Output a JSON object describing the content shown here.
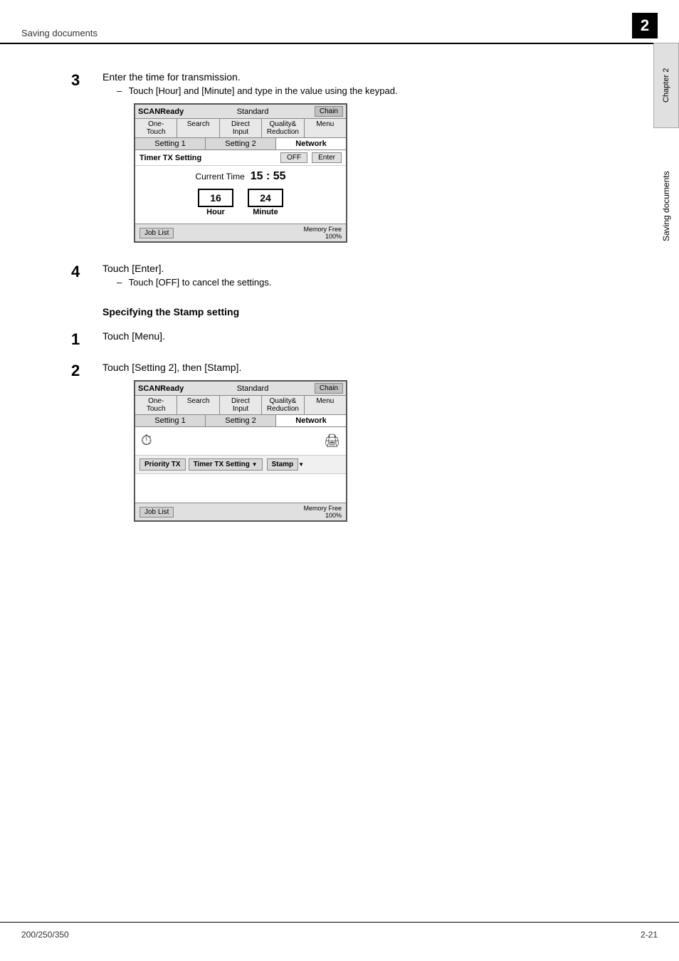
{
  "header": {
    "left_label": "Saving documents",
    "chapter_number": "2"
  },
  "sidebar": {
    "chapter_label": "Chapter 2",
    "saving_label": "Saving documents"
  },
  "steps": [
    {
      "number": "3",
      "main_text": "Enter the time for transmission.",
      "sub_text": "Touch [Hour] and [Minute] and type in the value using the keypad."
    },
    {
      "number": "4",
      "main_text": "Touch [Enter].",
      "sub_text": "Touch [OFF] to cancel the settings."
    }
  ],
  "stamp_section": {
    "heading": "Specifying the Stamp setting",
    "step1": {
      "number": "1",
      "text": "Touch [Menu]."
    },
    "step2": {
      "number": "2",
      "text": "Touch [Setting 2], then [Stamp]."
    }
  },
  "panel1": {
    "scan_ready": "SCANReady",
    "standard": "Standard",
    "chain_btn": "Chain",
    "nav_items": [
      "One-Touch",
      "Search",
      "Direct Input",
      "Quality& Reduction",
      "Menu"
    ],
    "tabs": [
      "Setting 1",
      "Setting 2",
      "Network"
    ],
    "timer_label": "Timer TX Setting",
    "off_btn": "OFF",
    "enter_btn": "Enter",
    "current_time_label": "Current Time",
    "current_time_value": "15 : 55",
    "hour_value": "16",
    "hour_label": "Hour",
    "minute_value": "24",
    "minute_label": "Minute",
    "job_list": "Job List",
    "memory_free": "Memory Free",
    "memory_percent": "100%"
  },
  "panel2": {
    "scan_ready": "SCANReady",
    "standard": "Standard",
    "chain_btn": "Chain",
    "nav_items": [
      "One-Touch",
      "Search",
      "Direct Input",
      "Quality& Reduction",
      "Menu"
    ],
    "tabs": [
      "Setting 1",
      "Setting 2",
      "Network"
    ],
    "priority_tx_btn": "Priority TX",
    "timer_tx_btn": "Timer TX Setting",
    "stamp_btn": "Stamp",
    "job_list": "Job List",
    "memory_free": "Memory Free",
    "memory_percent": "100%"
  },
  "footer": {
    "model": "200/250/350",
    "page": "2-21"
  }
}
